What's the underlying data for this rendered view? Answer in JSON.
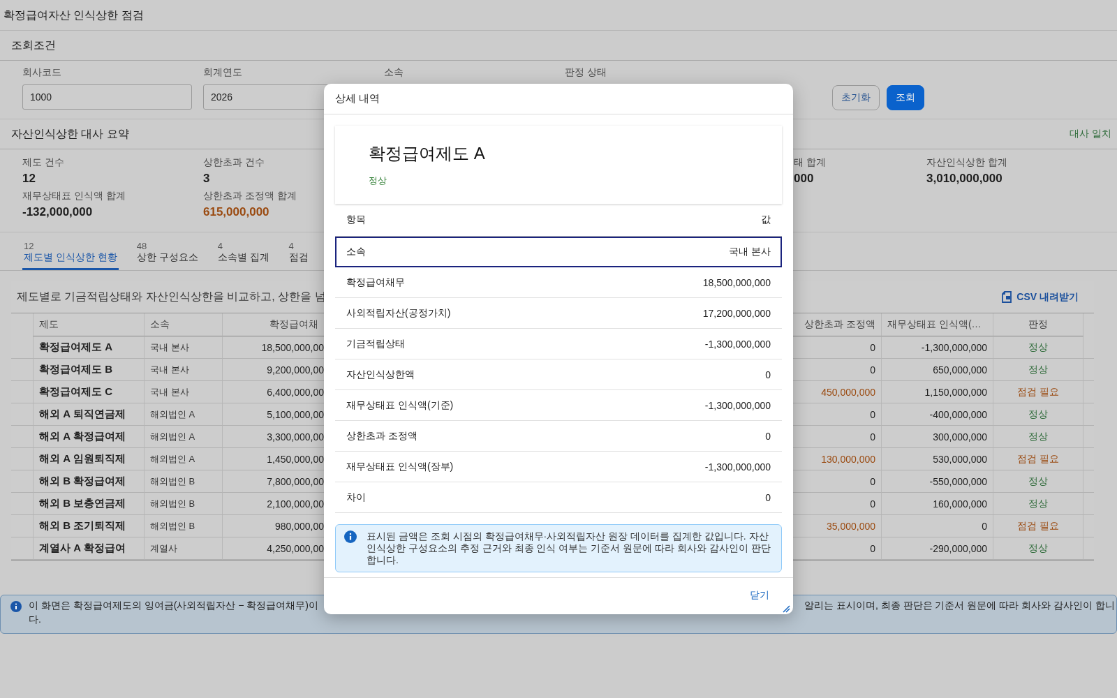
{
  "page_title": "확정급여자산 인식상한 점검",
  "filter": {
    "title": "조회조건",
    "fields": [
      {
        "label": "회사코드",
        "value": "1000"
      },
      {
        "label": "회계연도",
        "value": "2026"
      },
      {
        "label": "소속"
      },
      {
        "label": "판정 상태"
      }
    ],
    "buttons": [
      {
        "label": "초기화",
        "kind": "secondary"
      },
      {
        "label": "조회",
        "kind": "primary"
      }
    ]
  },
  "summary": {
    "title": "자산인식상한 대사 요약",
    "status": "대사 일치",
    "metrics": [
      {
        "label": "제도 건수",
        "value": "12",
        "kind": "plain"
      },
      {
        "label": "상한초과 건수",
        "value": "3",
        "kind": "plain"
      },
      {
        "label": "태 합계",
        "value": "000",
        "kind": "plain"
      },
      {
        "label": "자산인식상한 합계",
        "value": "3,010,000,000",
        "kind": "plain"
      },
      {
        "label": "재무상태표 인식액 합계",
        "value": "-132,000,000",
        "kind": "plain"
      },
      {
        "label": "상한초과 조정액 합계",
        "value": "615,000,000",
        "kind": "warning"
      }
    ]
  },
  "tabs": [
    {
      "count": "12",
      "label": "제도별 인식상한 현황",
      "selected": true
    },
    {
      "count": "48",
      "label": "상한 구성요소",
      "selected": false
    },
    {
      "count": "4",
      "label": "소속별 집계",
      "selected": false
    },
    {
      "count": "4",
      "label": "점검",
      "selected": false
    }
  ],
  "table": {
    "caption": "제도별로 기금적립상태와 자산인식상한을 비교하고, 상한을 넘",
    "csv_button": "CSV 내려받기",
    "columns": [
      "제도",
      "소속",
      "확정급여채",
      "상한초과 조정액",
      "재무상태표 인식액(…",
      "판정"
    ],
    "rows": [
      {
        "plan": "확정급여제도 A",
        "affiliation": "국내 본사",
        "dbo": "18,500,000,00",
        "excess": "0",
        "recognized": "-1,300,000,000",
        "judgement": "정상",
        "kind": "normal"
      },
      {
        "plan": "확정급여제도 B",
        "affiliation": "국내 본사",
        "dbo": "9,200,000,00",
        "excess": "0",
        "recognized": "650,000,000",
        "judgement": "정상",
        "kind": "normal"
      },
      {
        "plan": "확정급여제도 C",
        "affiliation": "국내 본사",
        "dbo": "6,400,000,00",
        "excess": "450,000,000",
        "recognized": "1,150,000,000",
        "judgement": "점검 필요",
        "kind": "review"
      },
      {
        "plan": "해외 A 퇴직연금제",
        "affiliation": "해외법인 A",
        "dbo": "5,100,000,00",
        "excess": "0",
        "recognized": "-400,000,000",
        "judgement": "정상",
        "kind": "normal"
      },
      {
        "plan": "해외 A 확정급여제",
        "affiliation": "해외법인 A",
        "dbo": "3,300,000,00",
        "excess": "0",
        "recognized": "300,000,000",
        "judgement": "정상",
        "kind": "normal"
      },
      {
        "plan": "해외 A 임원퇴직제",
        "affiliation": "해외법인 A",
        "dbo": "1,450,000,00",
        "excess": "130,000,000",
        "recognized": "530,000,000",
        "judgement": "점검 필요",
        "kind": "review"
      },
      {
        "plan": "해외 B 확정급여제",
        "affiliation": "해외법인 B",
        "dbo": "7,800,000,00",
        "excess": "0",
        "recognized": "-550,000,000",
        "judgement": "정상",
        "kind": "normal"
      },
      {
        "plan": "해외 B 보충연금제",
        "affiliation": "해외법인 B",
        "dbo": "2,100,000,00",
        "excess": "0",
        "recognized": "160,000,000",
        "judgement": "정상",
        "kind": "normal"
      },
      {
        "plan": "해외 B 조기퇴직제",
        "affiliation": "해외법인 B",
        "dbo": "980,000,00",
        "excess": "35,000,000",
        "recognized": "0",
        "judgement": "점검 필요",
        "kind": "review"
      },
      {
        "plan": "계열사 A 확정급여",
        "affiliation": "계열사",
        "dbo": "4,250,000,00",
        "excess": "0",
        "recognized": "-290,000,000",
        "judgement": "정상",
        "kind": "normal"
      }
    ]
  },
  "notice": {
    "text_left": "이 화면은 확정급여제도의 잉여금(사외적립자산 − 확정급여채무)이",
    "text_right": "알리는 표시이며, 최종 판단은 기준서 원문에 따라 회사와 감사인이 합니",
    "text_wrap": "다."
  },
  "dialog": {
    "title": "상세 내역",
    "plan": "확정급여제도 A",
    "judgement": "정상",
    "kind": "normal",
    "headers": [
      "항목",
      "값"
    ],
    "rows": [
      {
        "item": "소속",
        "value": "국내 본사",
        "selected": true
      },
      {
        "item": "확정급여채무",
        "value": "18,500,000,000",
        "selected": false
      },
      {
        "item": "사외적립자산(공정가치)",
        "value": "17,200,000,000",
        "selected": false
      },
      {
        "item": "기금적립상태",
        "value": "-1,300,000,000",
        "selected": false
      },
      {
        "item": "자산인식상한액",
        "value": "0",
        "selected": false
      },
      {
        "item": "재무상태표 인식액(기준)",
        "value": "-1,300,000,000",
        "selected": false
      },
      {
        "item": "상한초과 조정액",
        "value": "0",
        "selected": false
      },
      {
        "item": "재무상태표 인식액(장부)",
        "value": "-1,300,000,000",
        "selected": false
      },
      {
        "item": "차이",
        "value": "0",
        "selected": false
      }
    ],
    "info": "표시된 금액은 조회 시점의 확정급여채무·사외적립자산 원장 데이터를 집계한 값입니다. 자산인식상한 구성요소의 추정 근거와 최종 인식 여부는 기준서 원문에 따라 회사와 감사인이 판단합니다.",
    "close_button": "닫기"
  }
}
